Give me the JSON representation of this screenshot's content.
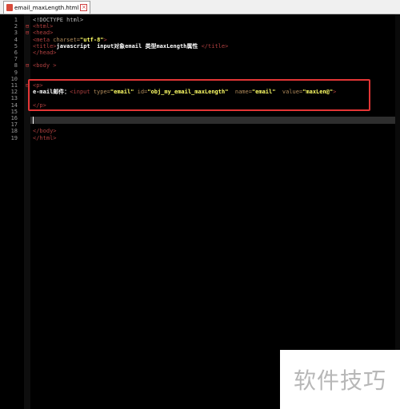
{
  "tab": {
    "filename": "email_maxLength.html"
  },
  "lines": [
    {
      "n": "1",
      "segments": [
        [
          "doctype",
          "<!DOCTYPE html>"
        ]
      ]
    },
    {
      "n": "2",
      "fold": "⊟",
      "segments": [
        [
          "tag",
          "<html>"
        ]
      ]
    },
    {
      "n": "3",
      "fold": "⊟",
      "segments": [
        [
          "tag",
          "<head>"
        ]
      ]
    },
    {
      "n": "4",
      "segments": [
        [
          "tag",
          "<meta "
        ],
        [
          "attr",
          "charset="
        ],
        [
          "val",
          "\"utf-8\""
        ],
        [
          "tag",
          ">"
        ]
      ]
    },
    {
      "n": "5",
      "segments": [
        [
          "tag",
          "<title>"
        ],
        [
          "strong",
          "javascript  input对象email 类型maxLength属性 "
        ],
        [
          "tag",
          "</title>"
        ]
      ]
    },
    {
      "n": "6",
      "segments": [
        [
          "tag",
          "</head>"
        ]
      ]
    },
    {
      "n": "7",
      "segments": []
    },
    {
      "n": "8",
      "fold": "⊟",
      "segments": [
        [
          "tag",
          "<body >"
        ]
      ]
    },
    {
      "n": "9",
      "segments": []
    },
    {
      "n": "10",
      "segments": []
    },
    {
      "n": "11",
      "fold": "⊟",
      "segments": [
        [
          "tag",
          "<p>"
        ]
      ]
    },
    {
      "n": "12",
      "segments": [
        [
          "strong",
          "e-mail邮件："
        ],
        [
          "tag",
          "<input "
        ],
        [
          "attr",
          "type="
        ],
        [
          "val",
          "\"email\""
        ],
        [
          "attr",
          " id="
        ],
        [
          "val",
          "\"obj_my_email_maxLength\""
        ],
        [
          "attr",
          "  name="
        ],
        [
          "val",
          "\"email\""
        ],
        [
          "attr",
          "  value="
        ],
        [
          "val",
          "\"maxLen@\""
        ],
        [
          "tag",
          ">"
        ]
      ]
    },
    {
      "n": "13",
      "segments": []
    },
    {
      "n": "14",
      "segments": [
        [
          "tag",
          "</p>"
        ]
      ]
    },
    {
      "n": "15",
      "segments": []
    },
    {
      "n": "16",
      "segments": []
    },
    {
      "n": "17",
      "segments": []
    },
    {
      "n": "18",
      "segments": [
        [
          "tag",
          "</body>"
        ]
      ]
    },
    {
      "n": "19",
      "segments": [
        [
          "tag",
          "</html>"
        ]
      ]
    }
  ],
  "watermark": {
    "text": "软件技巧"
  },
  "colors": {
    "tag": "#b04040",
    "attr": "#b08a5a",
    "value": "#ffff66",
    "highlight_box": "#e33535",
    "background": "#000000"
  }
}
